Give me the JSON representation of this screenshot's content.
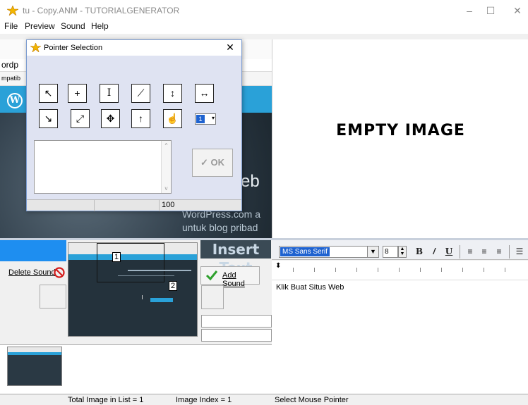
{
  "window": {
    "title": "tu - Copy.ANM - TUTORIALGENERATOR",
    "controls": {
      "minimize": "–",
      "maximize": "☐",
      "close": "✕"
    }
  },
  "menu": [
    "File",
    "Preview",
    "Sound",
    "Help"
  ],
  "background_snapshot": {
    "addr_fragment": "ordp",
    "tab_fragment": "mpatib",
    "wp_logo": "W",
    "hero_word": "eb",
    "hero_line1": "WordPress.com a",
    "hero_line2": "untuk blog pribad"
  },
  "pointer_dialog": {
    "title": "Pointer Selection",
    "close": "✕",
    "pointer_rows": [
      [
        "↖",
        "+",
        "I",
        "⟋",
        "↕",
        "↔"
      ],
      [
        "↘",
        "⤢",
        "✥",
        "↑",
        "☝",
        "1"
      ]
    ],
    "ok_label": "✓ OK",
    "status_value": "100"
  },
  "preview": {
    "label": "EMPTY IMAGE"
  },
  "sound": {
    "delete_label": "Delete Sound",
    "add_label": "Add Sound",
    "insert_text": "Insert Text"
  },
  "thumbnail": {
    "marker1": "1",
    "marker2": "2"
  },
  "status": {
    "total_images": "Total Image in List = 1",
    "image_index": "Image Index = 1",
    "right": "Select Mouse Pointer"
  },
  "editor": {
    "font_name": "MS Sans Serif",
    "font_size": "8",
    "bold": "B",
    "italic": "/",
    "underline": "U",
    "align_left": "≡",
    "align_center": "≡",
    "align_right": "≡",
    "bullets": "☰",
    "text": "Klik Buat Situs Web"
  },
  "colors": {
    "accent_blue": "#1e8ef0",
    "wp_blue": "#2aa1d8",
    "selection": "#1e62d0"
  }
}
